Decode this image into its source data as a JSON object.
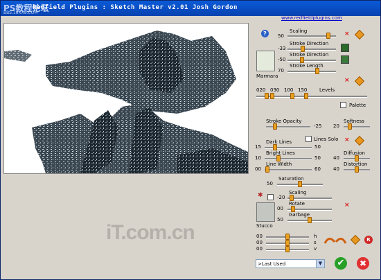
{
  "window": {
    "title": "Redfield Plugins : Sketch Master v2.01   Josh Gordon",
    "watermark_top": "PS教程论坛",
    "watermark_sub": "BBS.16XX8.COM",
    "link": "www.redfieldplugins.com"
  },
  "watermark_logo": "iT.com.cn",
  "brush1": {
    "scaling_label": "Scaling",
    "scaling_value": "50",
    "scaling_pct": 0.88,
    "stroke_dir1_label": "Stroke Direction",
    "stroke_dir1_value": "-33",
    "stroke_dir1_pct": 0.3,
    "stroke_dir2_label": "Stroke Direction",
    "stroke_dir2_value": "-50",
    "stroke_dir2_pct": 0.28,
    "stroke_len_label": "Stroke Length",
    "stroke_len_value": "70",
    "stroke_len_pct": 0.62,
    "texture_name": "Marmara"
  },
  "levels": {
    "label": "Levels",
    "values": [
      "020",
      "030",
      "100",
      "150"
    ],
    "thumb_pcts": [
      0.08,
      0.13,
      0.32,
      0.45
    ]
  },
  "palette": {
    "label": "Palette"
  },
  "opacity": {
    "stroke_opacity_label": "Stroke Opacity",
    "stroke_opacity_value": "-25",
    "stroke_opacity_pct": 0.18,
    "softness_label": "Softness",
    "softness_value": "20",
    "softness_pct": 0.2
  },
  "lines": {
    "dark_lines_label": "Dark Lines",
    "dark_min": "15",
    "dark_max": "50",
    "dark_pct": 0.2,
    "lines_solo_label": "Lines Solo",
    "bright_lines_label": "Bright Lines",
    "bright_min": "10",
    "bright_max": "50",
    "bright_pct": 0.28,
    "diffusion_label": "Diffusion",
    "diffusion_value": "40",
    "diffusion_pct": 0.5,
    "line_width_label": "Line Width",
    "width_min": "00",
    "width_max": "60",
    "width_pct": 0.02,
    "distortion_label": "Distortion",
    "distortion_value": "40",
    "distortion_pct": 0.5
  },
  "saturation": {
    "label": "Saturation",
    "value": "50",
    "pct": 0.5
  },
  "brush2": {
    "scaling_label": "Scaling",
    "scaling_value": "-20",
    "scaling_pct": 0.05,
    "rotate_label": "Rotate",
    "rotate_value": "00",
    "rotate_pct": 0.08,
    "garbage_label": "Garbage",
    "garbage_value": "50",
    "garbage_pct": 0.5,
    "texture_name": "Stucco"
  },
  "hsv": {
    "h_label": "h",
    "h_value": "00",
    "h_pct": 0.5,
    "s_label": "s",
    "s_value": "00",
    "s_pct": 0.5,
    "v_label": "v",
    "v_value": "00",
    "v_pct": 0.5
  },
  "preset": {
    "selected": ">Last Used"
  },
  "icons": {
    "accent": "#e89820",
    "close": "#d81818",
    "ok": "#28a028",
    "cancel": "#e03030"
  }
}
